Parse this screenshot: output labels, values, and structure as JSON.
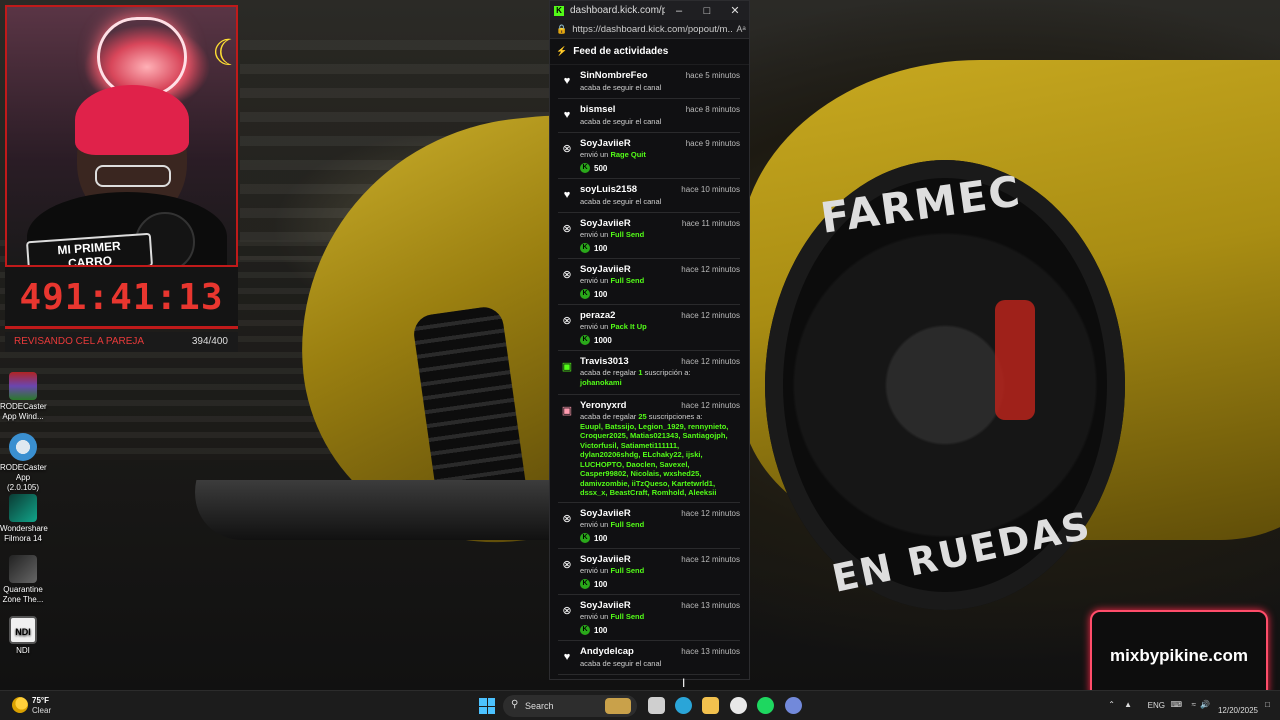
{
  "stream_overlay": {
    "webcam_badge_line1": "MI PRIMER",
    "webcam_badge_line2": "CARRO",
    "timer": "491:41:13",
    "goal_label": "REVISANDO CEL A PAREJA",
    "goal_count": "394/400",
    "tire_text_top": "FARMEC",
    "tire_text_bottom": "EN RUEDAS",
    "brand_box": "mixbypikine.com"
  },
  "desktop_icons": [
    {
      "label_line1": "RODECaster",
      "label_line2": "App Wind...",
      "icon": "winrar-archive-icon",
      "color": "#b02424"
    },
    {
      "label_line1": "RODECaster",
      "label_line2": "App (2.0.105)",
      "icon": "rodecaster-app-icon",
      "color": "#3a8fd0"
    },
    {
      "label_line1": "Wondershare",
      "label_line2": "Filmora 14",
      "icon": "filmora-icon",
      "color": "#11a58a"
    },
    {
      "label_line1": "Quarantine",
      "label_line2": "Zone The...",
      "icon": "quarantine-zone-game-icon",
      "color": "#4a4a4a"
    },
    {
      "label_line1": "NDI",
      "label_line2": "",
      "icon": "ndi-icon",
      "color": "#f0f0f0"
    }
  ],
  "popup": {
    "tab_title": "dashboard.kick.com/po...",
    "url": "https://dashboard.kick.com/popout/m...",
    "section_title": "Feed de actividades",
    "accent": "#53fc18",
    "items": [
      {
        "type": "follow",
        "user": "SinNombreFeo",
        "time": "hace 5 minutos",
        "text": "acaba de seguir el canal"
      },
      {
        "type": "follow",
        "user": "bismsel",
        "time": "hace 8 minutos",
        "text": "acaba de seguir el canal"
      },
      {
        "type": "kicks",
        "user": "SoyJaviieR",
        "time": "hace 9 minutos",
        "pre": "envió un ",
        "gift": "Rage Quit",
        "amount": "500"
      },
      {
        "type": "follow",
        "user": "soyLuis2158",
        "time": "hace 10 minutos",
        "text": "acaba de seguir el canal"
      },
      {
        "type": "kicks",
        "user": "SoyJaviieR",
        "time": "hace 11 minutos",
        "pre": "envió un ",
        "gift": "Full Send",
        "amount": "100"
      },
      {
        "type": "kicks",
        "user": "SoyJaviieR",
        "time": "hace 12 minutos",
        "pre": "envió un ",
        "gift": "Full Send",
        "amount": "100"
      },
      {
        "type": "kicks",
        "user": "peraza2",
        "time": "hace 12 minutos",
        "pre": "envió un ",
        "gift": "Pack It Up",
        "amount": "1000"
      },
      {
        "type": "giftsub",
        "user": "Travis3013",
        "time": "hace 12 minutos",
        "pre": "acaba de regalar ",
        "count": "1",
        "post": " suscripción a:",
        "recipients": "johanokami"
      },
      {
        "type": "giftsub",
        "user": "Yeronyxrd",
        "time": "hace 12 minutos",
        "pre": "acaba de regalar ",
        "count": "25",
        "post": " suscripciones a:",
        "recipients": "Euupl, Batssijo, Legion_1929, rennynieto, Croquer2025, Matias021343, Santiagojph, Victorfusil, Satiameti111111, dylan20206shdg, ELchaky22, ijski, LUCHOPTO, Daoclen, Savexel, Casper99802, Nicolais, wxshed25, damivzombie, iiTzQueso, Kartetwrld1, dssx_x, BeastCraft, Romhold, Aleeksii"
      },
      {
        "type": "kicks",
        "user": "SoyJaviieR",
        "time": "hace 12 minutos",
        "pre": "envió un ",
        "gift": "Full Send",
        "amount": "100"
      },
      {
        "type": "kicks",
        "user": "SoyJaviieR",
        "time": "hace 12 minutos",
        "pre": "envió un ",
        "gift": "Full Send",
        "amount": "100"
      },
      {
        "type": "kicks",
        "user": "SoyJaviieR",
        "time": "hace 13 minutos",
        "pre": "envió un ",
        "gift": "Full Send",
        "amount": "100"
      },
      {
        "type": "follow",
        "user": "Andydelcap",
        "time": "hace 13 minutos",
        "text": "acaba de seguir el canal"
      }
    ]
  },
  "taskbar": {
    "weather_temp": "75°F",
    "weather_cond": "Clear",
    "search_label": "Search",
    "apps": [
      {
        "icon": "task-view-icon",
        "color": "#cfcfcf"
      },
      {
        "icon": "edge-browser-icon",
        "color": "#2aa5d8"
      },
      {
        "icon": "file-explorer-icon",
        "color": "#f2c14e"
      },
      {
        "icon": "obs-studio-icon",
        "color": "#e8e8e8"
      },
      {
        "icon": "spotify-icon",
        "color": "#1ed760"
      },
      {
        "icon": "discord-icon",
        "color": "#7289da"
      }
    ],
    "lang": "ENG",
    "date": "12/20/2025"
  }
}
